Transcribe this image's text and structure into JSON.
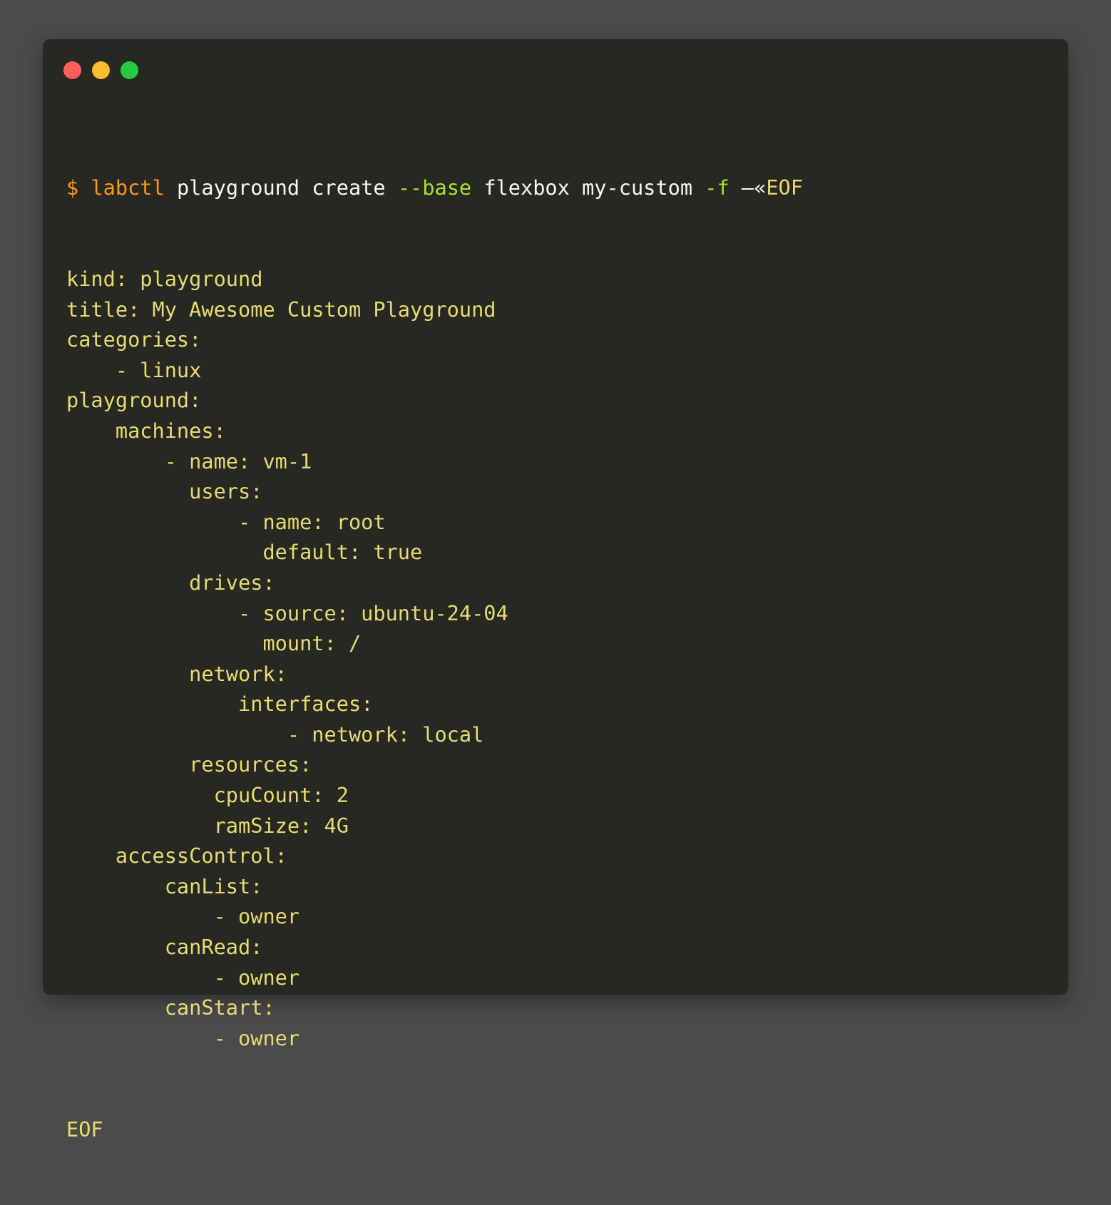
{
  "colors": {
    "page_background": "#4b4b4b",
    "window_background": "#272822",
    "close_dot": "#ff5f56",
    "minimize_dot": "#ffbd2e",
    "maximize_dot": "#27c93f",
    "prompt": "#fd971f",
    "command": "#fd971f",
    "argument": "#f8f8f2",
    "flag": "#a6e22e",
    "yaml_text": "#e6db74"
  },
  "window": {
    "controls": [
      {
        "name": "close-dot-icon"
      },
      {
        "name": "minimize-dot-icon"
      },
      {
        "name": "maximize-dot-icon"
      }
    ]
  },
  "command_line": {
    "prompt": "$",
    "command": "labctl",
    "arg1": "playground",
    "arg2": "create",
    "flag_base": "--base",
    "base_value": "flexbox",
    "name": "my-custom",
    "flag_file": "-f",
    "heredoc_arrow": "—«",
    "heredoc_marker": "EOF"
  },
  "yaml_lines": [
    "kind: playground",
    "title: My Awesome Custom Playground",
    "categories:",
    "    - linux",
    "playground:",
    "    machines:",
    "        - name: vm-1",
    "          users:",
    "              - name: root",
    "                default: true",
    "          drives:",
    "              - source: ubuntu-24-04",
    "                mount: /",
    "          network:",
    "              interfaces:",
    "                  - network: local",
    "          resources:",
    "            cpuCount: 2",
    "            ramSize: 4G",
    "    accessControl:",
    "        canList:",
    "            - owner",
    "        canRead:",
    "            - owner",
    "        canStart:",
    "            - owner"
  ],
  "heredoc_end": "EOF"
}
